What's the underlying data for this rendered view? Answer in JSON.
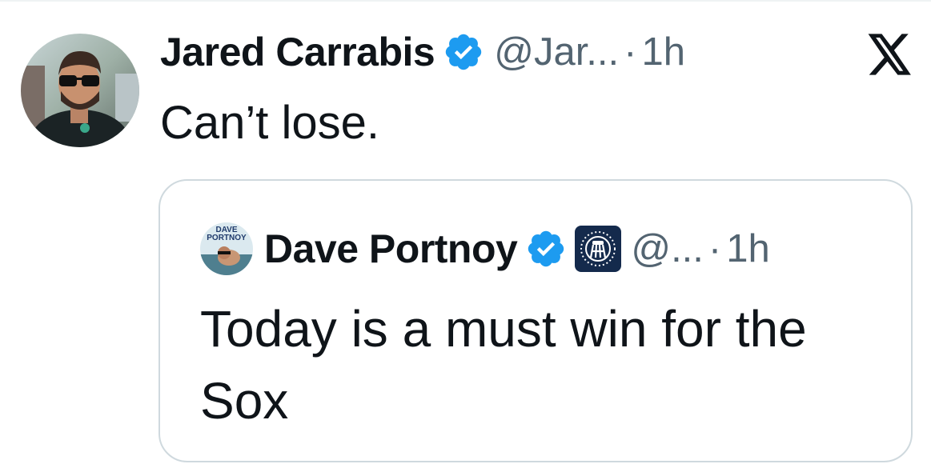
{
  "tweet": {
    "author_name": "Jared Carrabis",
    "handle": "@Jar...",
    "separator": "·",
    "time": "1h",
    "text": "Can’t lose."
  },
  "quoted_tweet": {
    "author_name": "Dave Portnoy",
    "avatar_text": [
      "DAVE",
      "PORTNOY"
    ],
    "handle": "@...",
    "separator": "·",
    "time": "1h",
    "text": "Today is a must win for the Sox"
  },
  "icons": {
    "verified": "verified-badge-icon",
    "x_logo": "x-logo-icon",
    "affiliate": "barstool-affiliate-badge"
  },
  "colors": {
    "verified_blue": "#1d9bf0",
    "text_primary": "#0f1419",
    "text_secondary": "#536471",
    "border": "#cfd9de",
    "affiliate_bg": "#142a4c"
  }
}
